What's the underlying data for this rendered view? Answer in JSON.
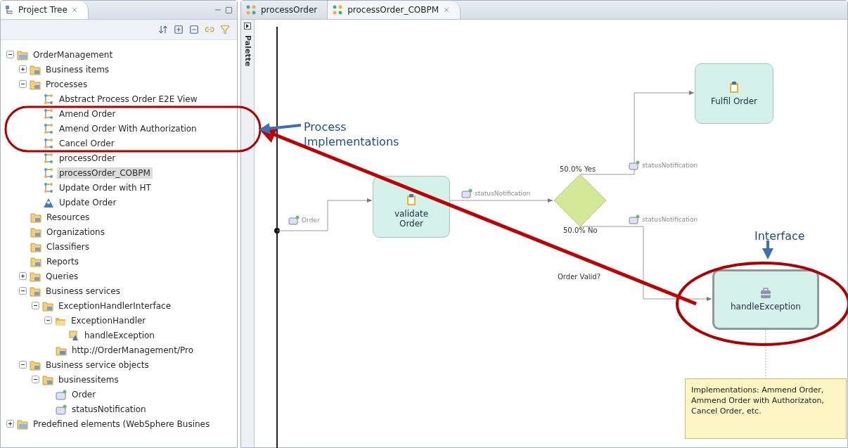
{
  "project_tree": {
    "title": "Project Tree",
    "items": [
      {
        "label": "OrderManagement",
        "kind": "project",
        "expanded": true,
        "selected": false,
        "children": [
          {
            "label": "Business items",
            "kind": "folder",
            "expanded": false,
            "selected": false
          },
          {
            "label": "Processes",
            "kind": "folder",
            "expanded": true,
            "selected": false,
            "children": [
              {
                "label": "Abstract Process Order E2E View",
                "kind": "process",
                "selected": false
              },
              {
                "label": "Amend Order",
                "kind": "process",
                "selected": false
              },
              {
                "label": "Amend Order With Authorization",
                "kind": "process",
                "selected": false
              },
              {
                "label": "Cancel Order",
                "kind": "process",
                "selected": false
              },
              {
                "label": "processOrder",
                "kind": "process",
                "selected": false
              },
              {
                "label": "processOrder_COBPM",
                "kind": "process",
                "selected": true
              },
              {
                "label": "Update Order with HT",
                "kind": "process",
                "selected": false
              },
              {
                "label": "Update Order",
                "kind": "human-task",
                "selected": false
              }
            ]
          },
          {
            "label": "Resources",
            "kind": "folder",
            "selected": false
          },
          {
            "label": "Organizations",
            "kind": "folder",
            "selected": false
          },
          {
            "label": "Classifiers",
            "kind": "folder",
            "selected": false
          },
          {
            "label": "Reports",
            "kind": "folder",
            "selected": false
          },
          {
            "label": "Queries",
            "kind": "folder",
            "expanded": false,
            "selected": false
          },
          {
            "label": "Business services",
            "kind": "folder",
            "expanded": true,
            "selected": false,
            "children": [
              {
                "label": "ExceptionHandlerInterface",
                "kind": "folder",
                "expanded": true,
                "selected": false,
                "children": [
                  {
                    "label": "ExceptionHandler",
                    "kind": "open-folder",
                    "expanded": true,
                    "selected": false,
                    "children": [
                      {
                        "label": "handleException",
                        "kind": "operation",
                        "selected": false
                      }
                    ]
                  },
                  {
                    "label": "http://OrderManagement/Pro",
                    "kind": "service",
                    "selected": false
                  }
                ]
              }
            ]
          },
          {
            "label": "Business service objects",
            "kind": "folder",
            "expanded": true,
            "selected": false,
            "children": [
              {
                "label": "businessitems",
                "kind": "folder",
                "expanded": true,
                "selected": false,
                "children": [
                  {
                    "label": "Order",
                    "kind": "data",
                    "selected": false
                  },
                  {
                    "label": "statusNotification",
                    "kind": "data",
                    "selected": false
                  }
                ]
              }
            ]
          }
        ]
      },
      {
        "label": "Predefined elements (WebSphere Busines",
        "kind": "project",
        "expanded": false,
        "selected": false
      }
    ]
  },
  "editor_tabs": [
    {
      "label": "processOrder",
      "selected": false
    },
    {
      "label": "processOrder_COBPM",
      "selected": true
    }
  ],
  "palette": {
    "label": "Palette"
  },
  "diagram": {
    "nodes": [
      {
        "kind": "task",
        "label": "validate Order",
        "selected": false
      },
      {
        "kind": "decision",
        "label": "Order Valid?"
      },
      {
        "kind": "task",
        "label": "Fulfil Order",
        "selected": false
      },
      {
        "kind": "task",
        "label": "handleException",
        "selected": true
      },
      {
        "kind": "note",
        "label": "Implementations: Ammend Order, Ammend Order with Authorizaton, Cancel Order, etc."
      }
    ],
    "branch_labels": [
      "50.0% Yes",
      "50.0% No"
    ],
    "data_labels": [
      "Order",
      "statusNotification",
      "statusNotification",
      "statusNotification"
    ]
  },
  "callouts": [
    {
      "text": "Process Implementations"
    },
    {
      "text": "Interface"
    }
  ]
}
